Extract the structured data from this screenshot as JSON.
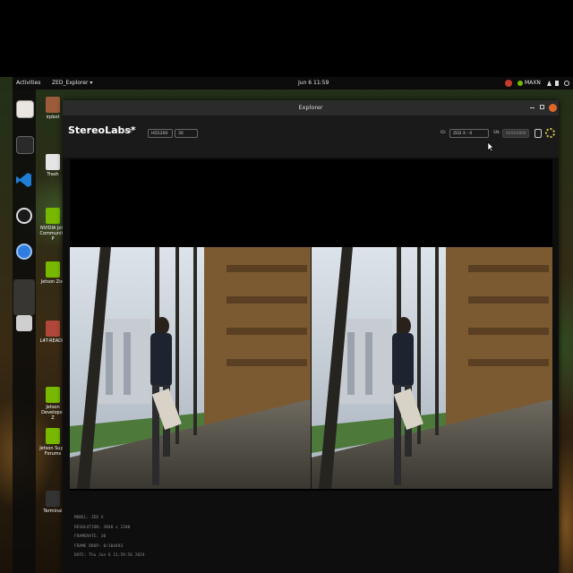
{
  "topbar": {
    "activities": "Activities",
    "app_menu": "ZED_Explorer ▾",
    "clock": "Jun 6 11:59",
    "power_mode": "MAXN"
  },
  "desktop_icons": [
    {
      "label": "irpbot"
    },
    {
      "label": "Trash"
    },
    {
      "label": "NVIDIA Jets Community P"
    },
    {
      "label": "Jetson Zoo"
    },
    {
      "label": "L4T-READM"
    },
    {
      "label": "Jetson Developer Z"
    },
    {
      "label": "Jetson Supp Forums"
    },
    {
      "label": "Terminal"
    }
  ],
  "window": {
    "title": "Explorer",
    "brand": "StereoLabs*",
    "live_label": "LIVE",
    "resolution_value": "HD1200",
    "fps_value": "30",
    "id_label": "ID:",
    "id_value": "ZED X - 0",
    "sn_label": "SN:",
    "sn_value": "44920806"
  },
  "camera_info": {
    "model": "MODEL: ZED X",
    "resolution": "RESOLUTION: 3840 x 1200",
    "framerate": "FRAMERATE: 30",
    "frame_drop": "FRAME DROP: 0/104493",
    "date": "DATE: Thu Jun 6 11:59:56 2024"
  },
  "colors": {
    "topbar": "#0c0c0c",
    "window_bg": "#0e0e0e",
    "titlebar": "#2b2b2b",
    "appbar": "#1a1a1a",
    "close_button": "#e0662a",
    "vscode_blue": "#1f7fd6",
    "chromium_blue": "#2f7de0",
    "nvidia_green": "#76b900",
    "settings_icon": "#d2c94a"
  }
}
